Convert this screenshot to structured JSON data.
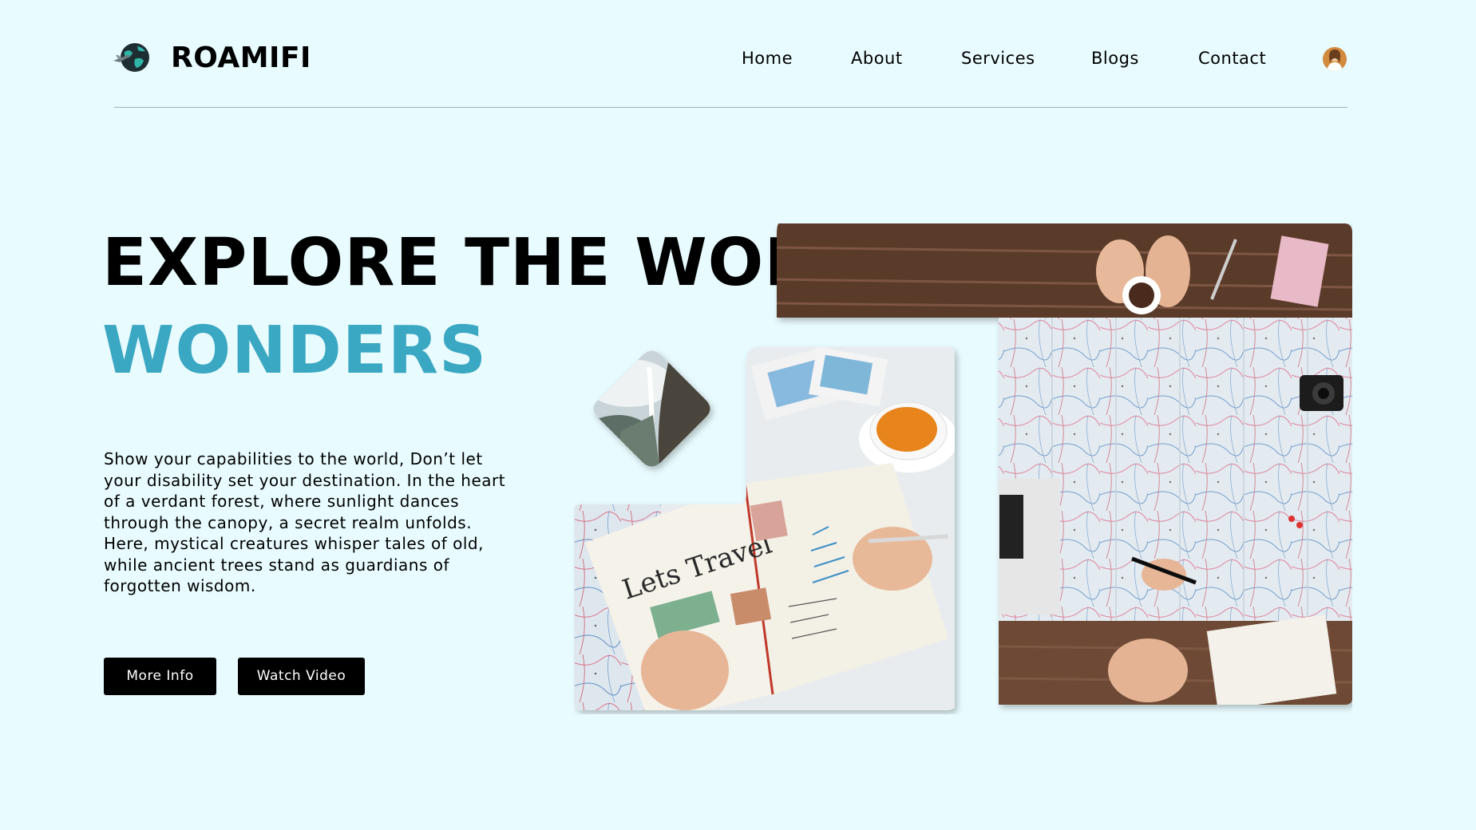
{
  "brand": {
    "name": "ROAMIFI",
    "logo_icon": "globe-airplane-icon"
  },
  "nav": {
    "items": [
      {
        "label": "Home"
      },
      {
        "label": "About"
      },
      {
        "label": "Services"
      },
      {
        "label": "Blogs"
      },
      {
        "label": "Contact"
      }
    ],
    "avatar_icon": "user-avatar"
  },
  "hero": {
    "headline": "EXPLORE THE WORLD’S",
    "headline_accent": "WONDERS",
    "description": "Show your capabilities to the world, Don’t let your disability set your destination. In the heart of a verdant forest, where sunlight dances through the canopy, a secret realm unfolds. Here, mystical creatures whisper tales of old, while ancient trees stand as guardians of forgotten wisdom.",
    "buttons": {
      "more_info": "More Info",
      "watch_video": "Watch Video"
    }
  },
  "collage": {
    "journal_text": "Lets Travel",
    "images": [
      "travel-map-table-photo",
      "mountain-waterfall-photo",
      "travel-journal-photo"
    ]
  },
  "colors": {
    "background": "#e8fbfe",
    "accent": "#3aa7c3",
    "button_bg": "#000000",
    "button_text": "#ffffff"
  }
}
